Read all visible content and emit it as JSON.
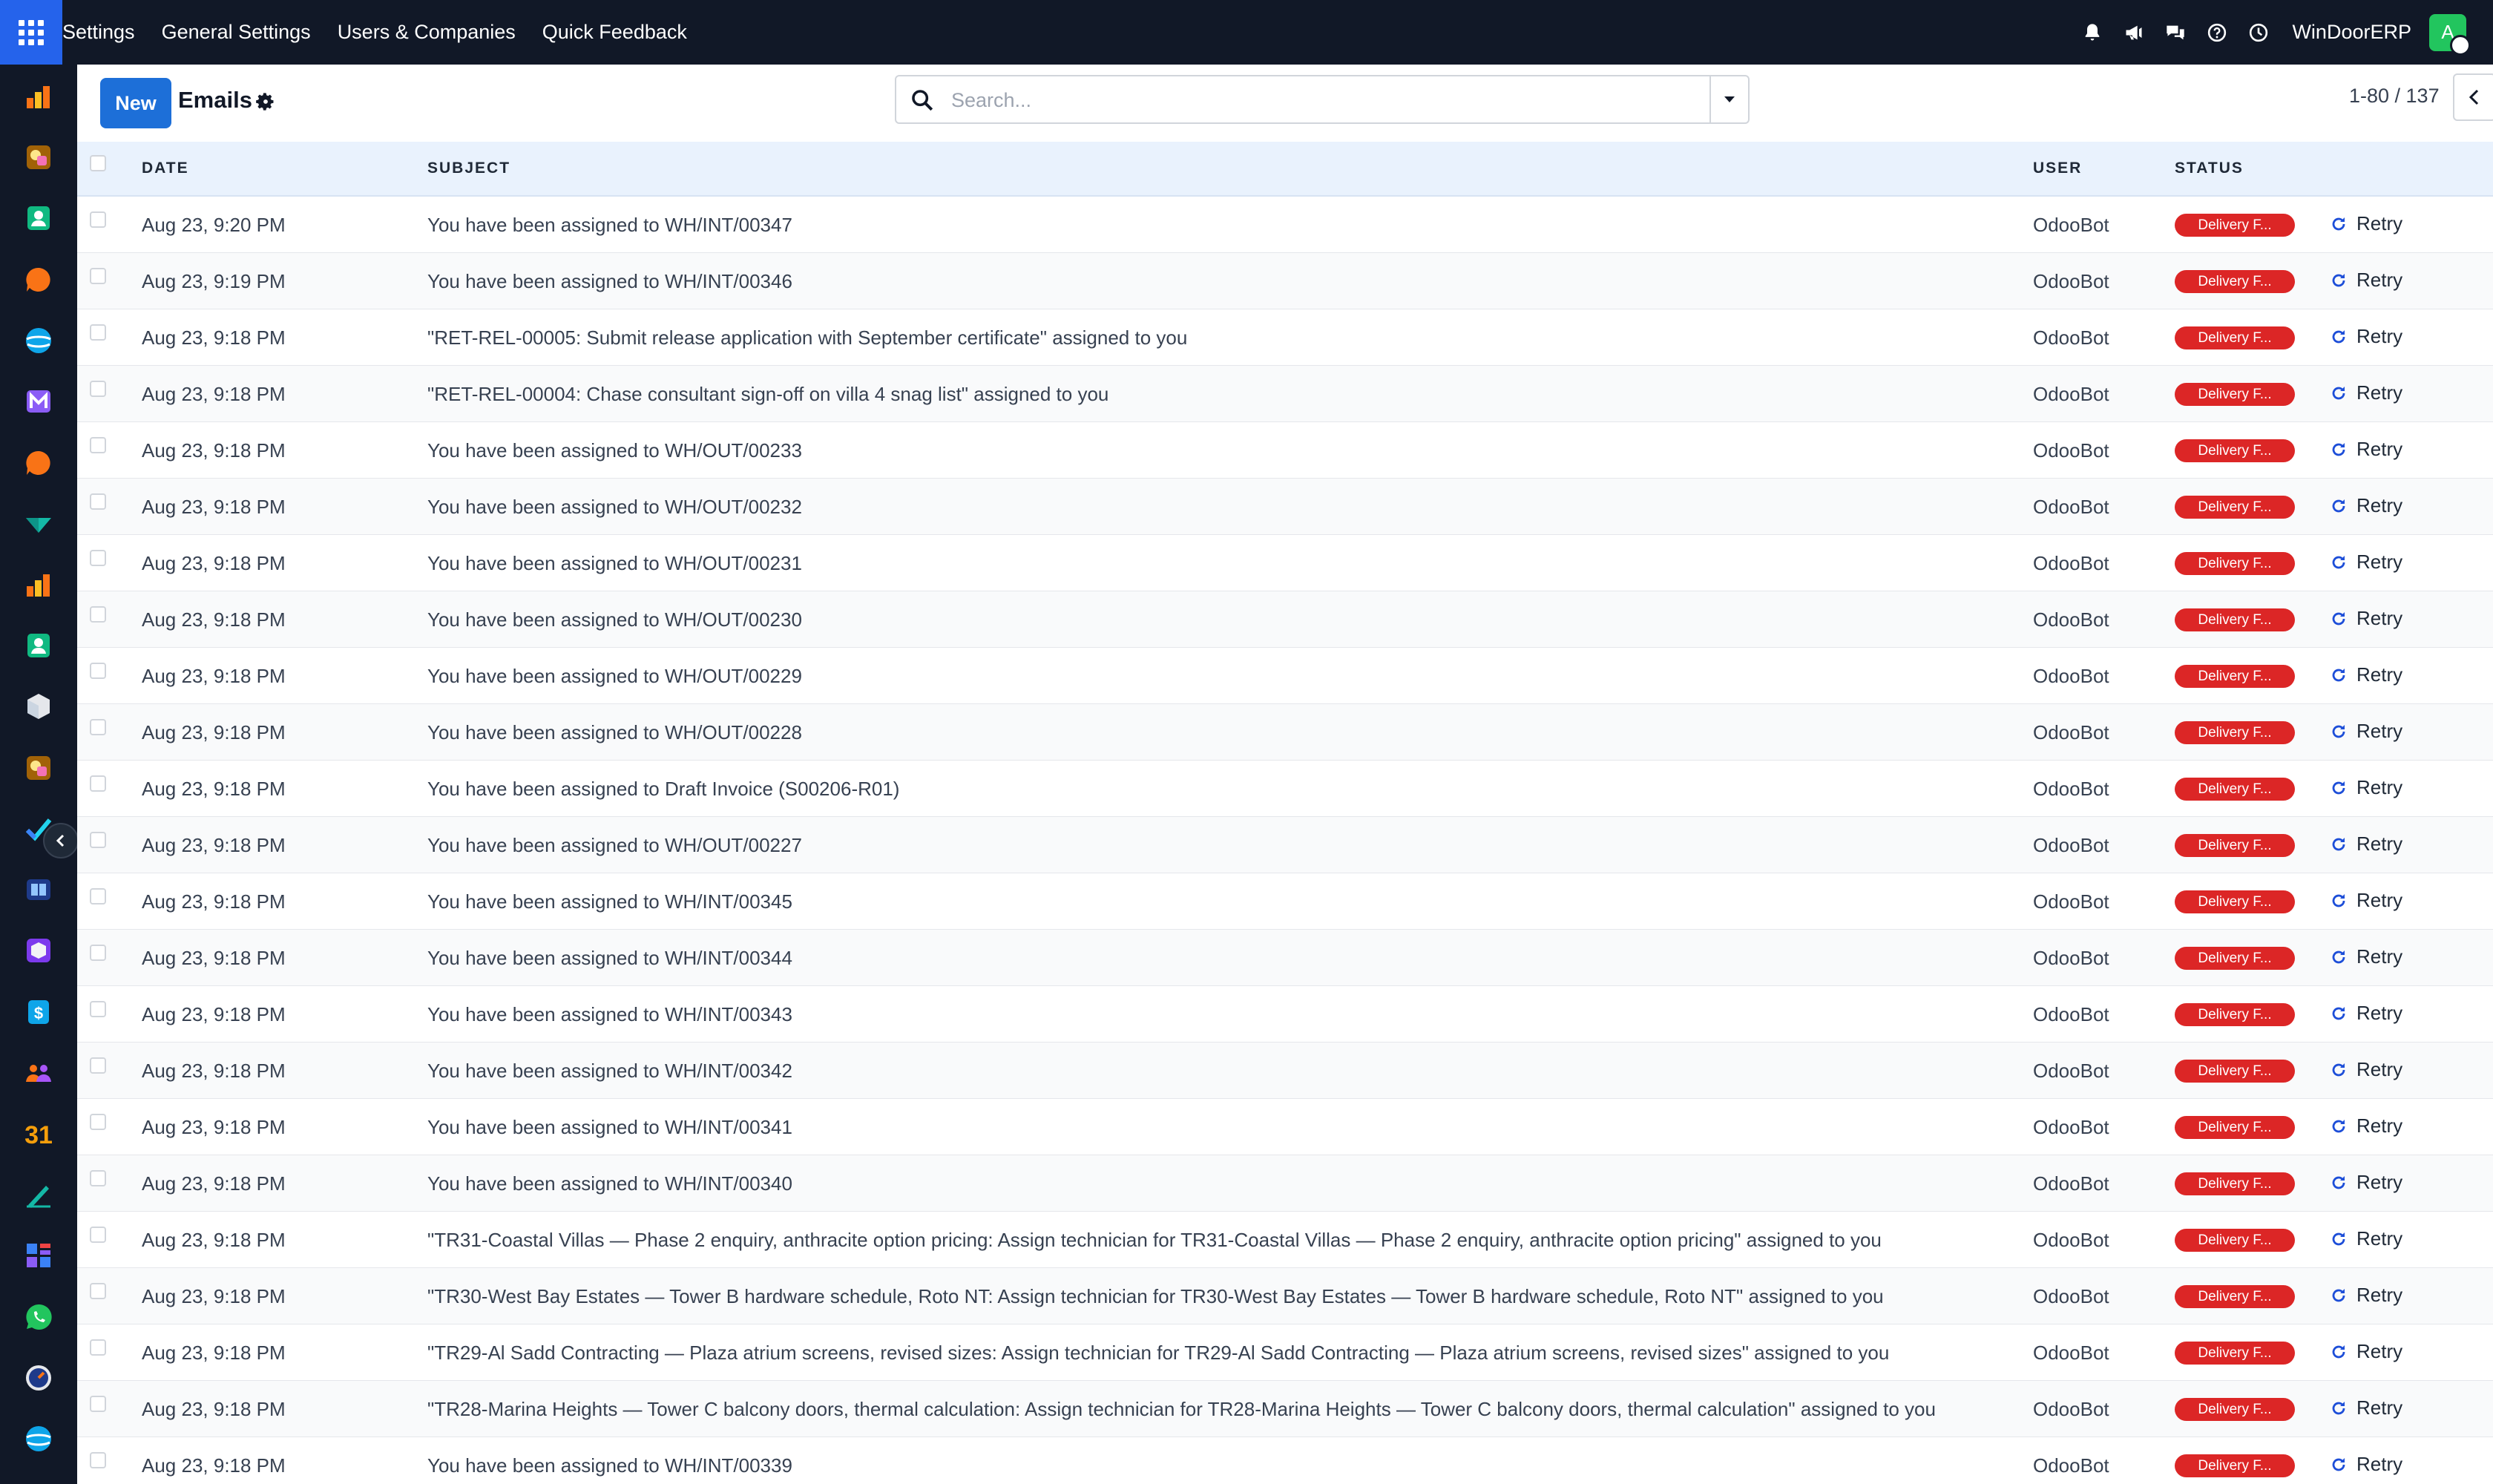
{
  "navbar": {
    "menu": [
      "Settings",
      "General Settings",
      "Users & Companies",
      "Quick Feedback"
    ],
    "company": "WinDoorERP",
    "avatar_initial": "A"
  },
  "sidebar": {
    "icons": [
      "inventory-icon",
      "sales-icon",
      "contacts-icon",
      "discuss-icon",
      "website-icon",
      "email-marketing-icon",
      "discuss-icon",
      "purchase-icon",
      "inventory-icon",
      "contacts-icon",
      "products-icon",
      "sales-icon",
      "todo-icon",
      "knowledge-icon",
      "inventory-box-icon",
      "invoicing-icon",
      "employees-icon",
      "calendar-icon",
      "sign-icon",
      "dashboards-icon",
      "whatsapp-icon",
      "timesheets-icon",
      "website-icon"
    ]
  },
  "control": {
    "new_label": "New",
    "title": "Emails",
    "search_placeholder": "Search...",
    "pager": "1-80 / 137"
  },
  "table": {
    "columns": {
      "date": "DATE",
      "subject": "SUBJECT",
      "user": "USER",
      "status": "STATUS"
    },
    "retry_label": "Retry",
    "status_color": "#dc2626",
    "rows": [
      {
        "date": "Aug 23, 9:20 PM",
        "subject": "You have been assigned to WH/INT/00347",
        "user": "OdooBot",
        "status": "Delivery F..."
      },
      {
        "date": "Aug 23, 9:19 PM",
        "subject": "You have been assigned to WH/INT/00346",
        "user": "OdooBot",
        "status": "Delivery F..."
      },
      {
        "date": "Aug 23, 9:18 PM",
        "subject": "\"RET-REL-00005: Submit release application with September certificate\" assigned to you",
        "user": "OdooBot",
        "status": "Delivery F..."
      },
      {
        "date": "Aug 23, 9:18 PM",
        "subject": "\"RET-REL-00004: Chase consultant sign-off on villa 4 snag list\" assigned to you",
        "user": "OdooBot",
        "status": "Delivery F..."
      },
      {
        "date": "Aug 23, 9:18 PM",
        "subject": "You have been assigned to WH/OUT/00233",
        "user": "OdooBot",
        "status": "Delivery F..."
      },
      {
        "date": "Aug 23, 9:18 PM",
        "subject": "You have been assigned to WH/OUT/00232",
        "user": "OdooBot",
        "status": "Delivery F..."
      },
      {
        "date": "Aug 23, 9:18 PM",
        "subject": "You have been assigned to WH/OUT/00231",
        "user": "OdooBot",
        "status": "Delivery F..."
      },
      {
        "date": "Aug 23, 9:18 PM",
        "subject": "You have been assigned to WH/OUT/00230",
        "user": "OdooBot",
        "status": "Delivery F..."
      },
      {
        "date": "Aug 23, 9:18 PM",
        "subject": "You have been assigned to WH/OUT/00229",
        "user": "OdooBot",
        "status": "Delivery F..."
      },
      {
        "date": "Aug 23, 9:18 PM",
        "subject": "You have been assigned to WH/OUT/00228",
        "user": "OdooBot",
        "status": "Delivery F..."
      },
      {
        "date": "Aug 23, 9:18 PM",
        "subject": "You have been assigned to Draft Invoice (S00206-R01)",
        "user": "OdooBot",
        "status": "Delivery F..."
      },
      {
        "date": "Aug 23, 9:18 PM",
        "subject": "You have been assigned to WH/OUT/00227",
        "user": "OdooBot",
        "status": "Delivery F..."
      },
      {
        "date": "Aug 23, 9:18 PM",
        "subject": "You have been assigned to WH/INT/00345",
        "user": "OdooBot",
        "status": "Delivery F..."
      },
      {
        "date": "Aug 23, 9:18 PM",
        "subject": "You have been assigned to WH/INT/00344",
        "user": "OdooBot",
        "status": "Delivery F..."
      },
      {
        "date": "Aug 23, 9:18 PM",
        "subject": "You have been assigned to WH/INT/00343",
        "user": "OdooBot",
        "status": "Delivery F..."
      },
      {
        "date": "Aug 23, 9:18 PM",
        "subject": "You have been assigned to WH/INT/00342",
        "user": "OdooBot",
        "status": "Delivery F..."
      },
      {
        "date": "Aug 23, 9:18 PM",
        "subject": "You have been assigned to WH/INT/00341",
        "user": "OdooBot",
        "status": "Delivery F..."
      },
      {
        "date": "Aug 23, 9:18 PM",
        "subject": "You have been assigned to WH/INT/00340",
        "user": "OdooBot",
        "status": "Delivery F..."
      },
      {
        "date": "Aug 23, 9:18 PM",
        "subject": "\"TR31-Coastal Villas — Phase 2 enquiry, anthracite option pricing: Assign technician for TR31-Coastal Villas — Phase 2 enquiry, anthracite option pricing\" assigned to you",
        "user": "OdooBot",
        "status": "Delivery F..."
      },
      {
        "date": "Aug 23, 9:18 PM",
        "subject": "\"TR30-West Bay Estates — Tower B hardware schedule, Roto NT: Assign technician for TR30-West Bay Estates — Tower B hardware schedule, Roto NT\" assigned to you",
        "user": "OdooBot",
        "status": "Delivery F..."
      },
      {
        "date": "Aug 23, 9:18 PM",
        "subject": "\"TR29-Al Sadd Contracting — Plaza atrium screens, revised sizes: Assign technician for TR29-Al Sadd Contracting — Plaza atrium screens, revised sizes\" assigned to you",
        "user": "OdooBot",
        "status": "Delivery F..."
      },
      {
        "date": "Aug 23, 9:18 PM",
        "subject": "\"TR28-Marina Heights — Tower C balcony doors, thermal calculation: Assign technician for TR28-Marina Heights — Tower C balcony doors, thermal calculation\" assigned to you",
        "user": "OdooBot",
        "status": "Delivery F..."
      },
      {
        "date": "Aug 23, 9:18 PM",
        "subject": "You have been assigned to WH/INT/00339",
        "user": "OdooBot",
        "status": "Delivery F..."
      }
    ]
  }
}
